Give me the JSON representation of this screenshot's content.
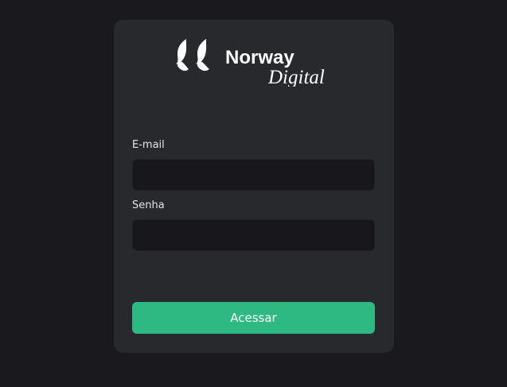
{
  "brand": {
    "name": "Norway",
    "subname": "Digital"
  },
  "form": {
    "email_label": "E-mail",
    "email_value": "",
    "password_label": "Senha",
    "password_value": "",
    "submit_label": "Acessar"
  },
  "colors": {
    "page_background": "#1a1a1e",
    "card_background": "#27292d",
    "input_background": "#18181c",
    "accent": "#2eb882"
  },
  "icons": {
    "logo": "norway-digital-logo-icon"
  }
}
